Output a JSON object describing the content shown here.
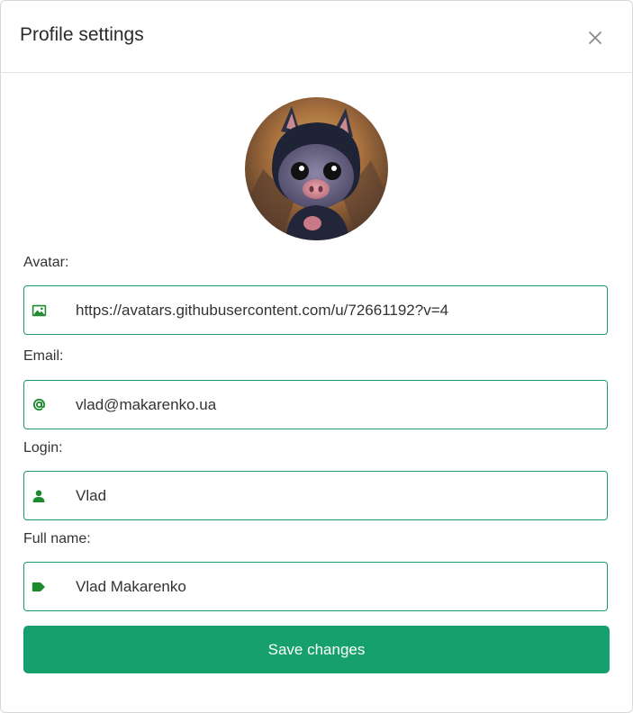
{
  "header": {
    "title": "Profile settings",
    "close_icon": "close-icon"
  },
  "avatar": {
    "alt": "Avatar"
  },
  "fields": {
    "avatar": {
      "label": "Avatar:",
      "value": "https://avatars.githubusercontent.com/u/72661192?v=4",
      "icon": "image-icon"
    },
    "email": {
      "label": "Email:",
      "value": "vlad@makarenko.ua",
      "icon": "at-icon"
    },
    "login": {
      "label": "Login:",
      "value": "Vlad",
      "icon": "user-icon"
    },
    "full_name": {
      "label": "Full name:",
      "value": "Vlad Makarenko",
      "icon": "tag-icon"
    }
  },
  "actions": {
    "save_label": "Save changes"
  },
  "colors": {
    "accent": "#15a06d",
    "icon": "#1e8a2e",
    "border": "#1a9a6c"
  }
}
